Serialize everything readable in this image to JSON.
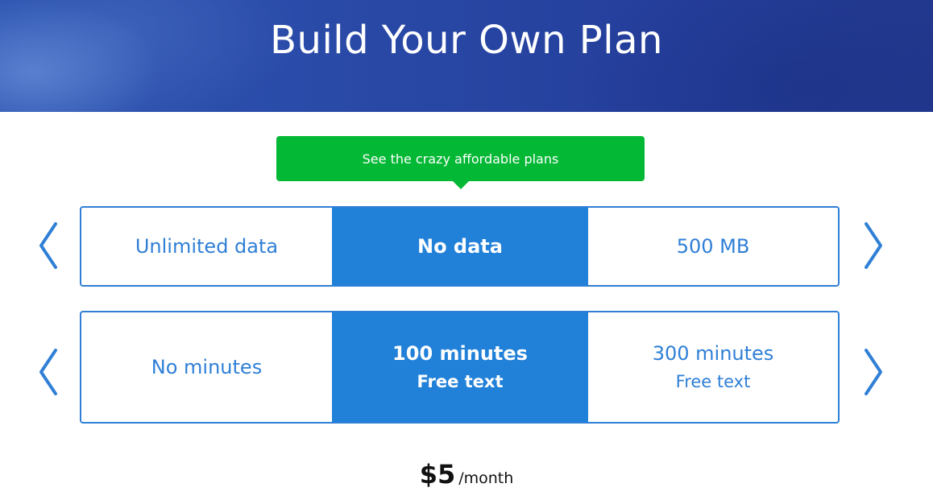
{
  "hero": {
    "title": "Build Your Own Plan"
  },
  "cta": {
    "label": "See the crazy affordable plans"
  },
  "data_selector": {
    "options": [
      {
        "label": "Unlimited data"
      },
      {
        "label": "No data",
        "selected": true
      },
      {
        "label": "500 MB"
      }
    ]
  },
  "minutes_selector": {
    "options": [
      {
        "label": "No minutes",
        "sub": ""
      },
      {
        "label": "100 minutes",
        "sub": "Free text",
        "selected": true
      },
      {
        "label": "300 minutes",
        "sub": "Free text"
      }
    ]
  },
  "price": {
    "amount": "$5",
    "period": "/month"
  },
  "colors": {
    "accent": "#2180d8",
    "cta": "#03b834",
    "hero": "#2a4aa8"
  },
  "icons": {
    "prev": "chevron-left-icon",
    "next": "chevron-right-icon"
  }
}
